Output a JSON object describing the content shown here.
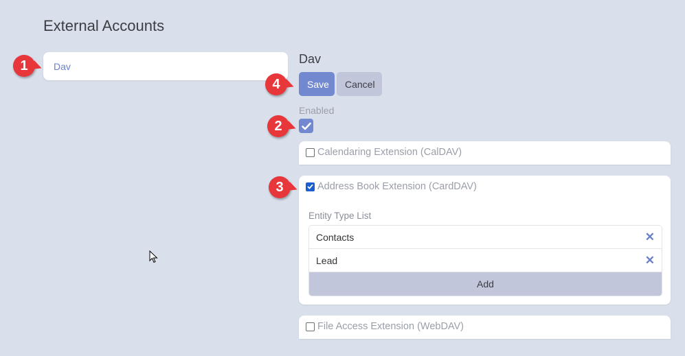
{
  "page": {
    "title": "External Accounts"
  },
  "sidebar": {
    "items": [
      {
        "label": "Dav",
        "selected": true
      }
    ]
  },
  "detail": {
    "title": "Dav",
    "buttons": {
      "save": "Save",
      "cancel": "Cancel"
    },
    "enabled": {
      "label": "Enabled",
      "checked": true
    },
    "extensions": [
      {
        "label": "Calendaring Extension (CalDAV)",
        "checked": false
      },
      {
        "label": "Address Book Extension (CardDAV)",
        "checked": true
      },
      {
        "label": "File Access Extension (WebDAV)",
        "checked": false
      }
    ],
    "entity_type_list": {
      "label": "Entity Type List",
      "items": [
        "Contacts",
        "Lead"
      ],
      "add_label": "Add",
      "remove_icon": "close-icon"
    }
  },
  "annotations": [
    "1",
    "2",
    "3",
    "4"
  ],
  "colors": {
    "accent": "#7289d0",
    "badge": "#e8373b",
    "background": "#d9e0eb"
  }
}
